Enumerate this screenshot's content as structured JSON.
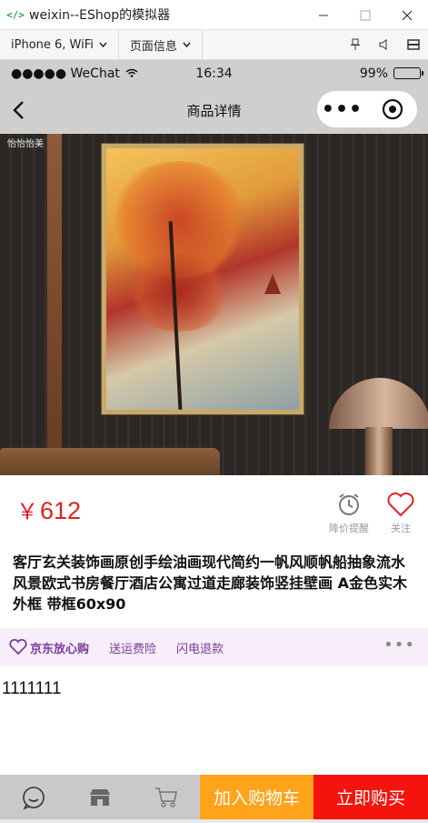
{
  "window": {
    "title": "weixin--EShop的模拟器",
    "app_icon": "code-icon",
    "controls": [
      "minimize",
      "maximize",
      "close"
    ]
  },
  "simulator_toolbar": {
    "device_select": "iPhone 6, WiFi",
    "page_info_select": "页面信息",
    "tools": [
      "pin-icon",
      "volume-icon",
      "window-icon"
    ]
  },
  "status_bar": {
    "carrier": "●●●●● WeChat",
    "time": "16:34",
    "battery": "99%",
    "battery_level": 0.99
  },
  "nav_bar": {
    "title": "商品详情",
    "more_label": "•••"
  },
  "hero": {
    "brand_logo": "怡怡怡美"
  },
  "product": {
    "currency": "￥",
    "price": "612",
    "alarm_label": "降价提醒",
    "follow_label": "关注",
    "name": "客厅玄关装饰画原创手绘油画现代简约一帆风顺帆船抽象流水风景欧式书房餐厅酒店公寓过道走廊装饰竖挂壁画 A金色实木外框 带框60x90"
  },
  "service": {
    "jd_label": "京东放心购",
    "items": [
      "送运费险",
      "闪电退款"
    ],
    "more": "•••"
  },
  "detail": {
    "text": "1111111"
  },
  "bottom_bar": {
    "icons": [
      "chat-icon",
      "store-icon",
      "cart-icon"
    ],
    "add_cart_label": "加入购物车",
    "buy_now_label": "立即购买"
  },
  "colors": {
    "price": "#e02020",
    "add_cart": "#ffa31a",
    "buy_now": "#f4130d",
    "service_text": "#7a3aa0",
    "service_bg": "#f7eefa",
    "nav_bg": "#cfcfcf"
  }
}
